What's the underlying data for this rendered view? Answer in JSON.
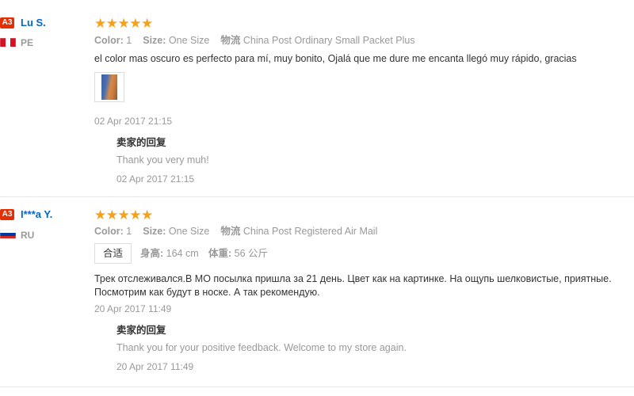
{
  "reviews": [
    {
      "user": {
        "badge": "A3",
        "name": "Lu S.",
        "country": "PE"
      },
      "stars": 5,
      "attrs": {
        "color_label": "Color:",
        "color_value": "1",
        "size_label": "Size:",
        "size_value": "One Size",
        "logistics_label": "物流",
        "logistics_value": "China Post Ordinary Small Packet Plus"
      },
      "comment": "el color mas oscuro es perfecto para mí, muy bonito, Ojalá que me dure me encanta llegó muy rápido, gracias",
      "date": "02 Apr 2017 21:15",
      "reply": {
        "title": "卖家的回复",
        "text": "Thank you very muh!",
        "date": "02 Apr 2017 21:15"
      }
    },
    {
      "user": {
        "badge": "A3",
        "name": "I***a Y.",
        "country": "RU"
      },
      "stars": 5,
      "attrs": {
        "color_label": "Color:",
        "color_value": "1",
        "size_label": "Size:",
        "size_value": "One Size",
        "logistics_label": "物流",
        "logistics_value": "China Post Registered Air Mail"
      },
      "fit": "合适",
      "height_label": "身高:",
      "height_value": "164 cm",
      "weight_label": "体重:",
      "weight_value": "56 公斤",
      "comment_line1": "Трек отслеживался.В МО посылка пришла за 21 день. Цвет как на картинке. На ощупь шелковистые, приятные.",
      "comment_line2": "Посмотрим как будут в носке. А так рекомендую.",
      "date": "20 Apr 2017 11:49",
      "reply": {
        "title": "卖家的回复",
        "text": "Thank you for your positive feedback. Welcome to my store again.",
        "date": "20 Apr 2017 11:49"
      }
    }
  ],
  "colors": {
    "star": "#f7a01a",
    "badge": "#e62e04",
    "link": "#0066cc"
  }
}
